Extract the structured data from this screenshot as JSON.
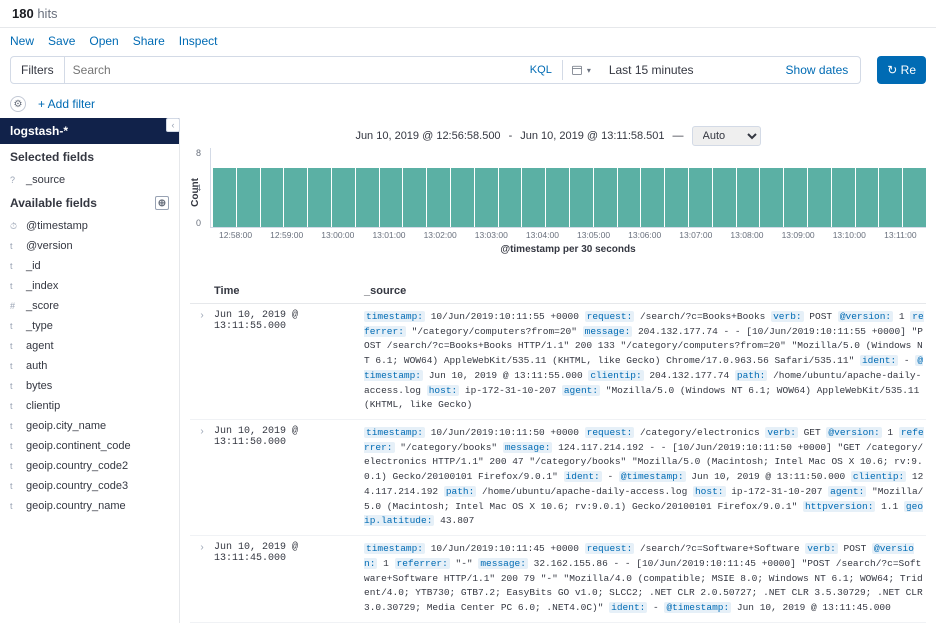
{
  "hits_count": "180",
  "hits_label": "hits",
  "menu": [
    "New",
    "Save",
    "Open",
    "Share",
    "Inspect"
  ],
  "filters_label": "Filters",
  "search_placeholder": "Search",
  "kql": "KQL",
  "time_range": "Last 15 minutes",
  "show_dates": "Show dates",
  "refresh": "Re",
  "add_filter": "+ Add filter",
  "index_pattern": "logstash-*",
  "selected_fields_label": "Selected fields",
  "selected_fields": [
    {
      "type": "?",
      "name": "_source"
    }
  ],
  "available_fields_label": "Available fields",
  "available_fields": [
    {
      "type": "⏱",
      "name": "@timestamp"
    },
    {
      "type": "t",
      "name": "@version"
    },
    {
      "type": "t",
      "name": "_id"
    },
    {
      "type": "t",
      "name": "_index"
    },
    {
      "type": "#",
      "name": "_score"
    },
    {
      "type": "t",
      "name": "_type"
    },
    {
      "type": "t",
      "name": "agent"
    },
    {
      "type": "t",
      "name": "auth"
    },
    {
      "type": "t",
      "name": "bytes"
    },
    {
      "type": "t",
      "name": "clientip"
    },
    {
      "type": "t",
      "name": "geoip.city_name"
    },
    {
      "type": "t",
      "name": "geoip.continent_code"
    },
    {
      "type": "t",
      "name": "geoip.country_code2"
    },
    {
      "type": "t",
      "name": "geoip.country_code3"
    },
    {
      "type": "t",
      "name": "geoip.country_name"
    }
  ],
  "chart_title_left": "Jun 10, 2019 @ 12:56:58.500",
  "chart_title_right": "Jun 10, 2019 @ 13:11:58.501",
  "chart_interval": "Auto",
  "xlabel": "@timestamp per 30 seconds",
  "ylabel": "Count",
  "table_headers": {
    "time": "Time",
    "source": "_source"
  },
  "chart_data": {
    "type": "bar",
    "title": "Jun 10, 2019 @ 12:56:58.500 - Jun 10, 2019 @ 13:11:58.501 — Auto",
    "xlabel": "@timestamp per 30 seconds",
    "ylabel": "Count",
    "ylim": [
      0,
      8
    ],
    "yticks": [
      8,
      4,
      0
    ],
    "categories": [
      "12:58:00",
      "12:59:00",
      "13:00:00",
      "13:01:00",
      "13:02:00",
      "13:03:00",
      "13:04:00",
      "13:05:00",
      "13:06:00",
      "13:07:00",
      "13:08:00",
      "13:09:00",
      "13:10:00",
      "13:11:00"
    ],
    "values": [
      6,
      6,
      6,
      6,
      6,
      6,
      6,
      6,
      6,
      6,
      6,
      6,
      6,
      6,
      6,
      6,
      6,
      6,
      6,
      6,
      6,
      6,
      6,
      6,
      6,
      6,
      6,
      6,
      6,
      6
    ]
  },
  "rows": [
    {
      "time": "Jun 10, 2019 @ 13:11:55.000",
      "source": "<span class='k'>timestamp:</span> 10/Jun/2019:10:11:55 +0000 <span class='k'>request:</span> /search/?c=Books+Books <span class='k'>verb:</span> POST <span class='k'>@version:</span> 1 <span class='k'>referrer:</span> \"/category/computers?from=20\" <span class='k'>message:</span> 204.132.177.74 - - [10/Jun/2019:10:11:55 +0000] \"POST /search/?c=Books+Books HTTP/1.1\" 200 133 \"/category/computers?from=20\" \"Mozilla/5.0 (Windows NT 6.1; WOW64) AppleWebKit/535.11 (KHTML, like Gecko) Chrome/17.0.963.56 Safari/535.11\" <span class='k'>ident:</span> - <span class='k'>@timestamp:</span> Jun 10, 2019 @ 13:11:55.000 <span class='k'>clientip:</span> 204.132.177.74 <span class='k'>path:</span> /home/ubuntu/apache-daily-access.log <span class='k'>host:</span> ip-172-31-10-207 <span class='k'>agent:</span> \"Mozilla/5.0 (Windows NT 6.1; WOW64) AppleWebKit/535.11 (KHTML, like Gecko)"
    },
    {
      "time": "Jun 10, 2019 @ 13:11:50.000",
      "source": "<span class='k'>timestamp:</span> 10/Jun/2019:10:11:50 +0000 <span class='k'>request:</span> /category/electronics <span class='k'>verb:</span> GET <span class='k'>@version:</span> 1 <span class='k'>referrer:</span> \"/category/books\" <span class='k'>message:</span> 124.117.214.192 - - [10/Jun/2019:10:11:50 +0000] \"GET /category/electronics HTTP/1.1\" 200 47 \"/category/books\" \"Mozilla/5.0 (Macintosh; Intel Mac OS X 10.6; rv:9.0.1) Gecko/20100101 Firefox/9.0.1\" <span class='k'>ident:</span> - <span class='k'>@timestamp:</span> Jun 10, 2019 @ 13:11:50.000 <span class='k'>clientip:</span> 124.117.214.192 <span class='k'>path:</span> /home/ubuntu/apache-daily-access.log <span class='k'>host:</span> ip-172-31-10-207 <span class='k'>agent:</span> \"Mozilla/5.0 (Macintosh; Intel Mac OS X 10.6; rv:9.0.1) Gecko/20100101 Firefox/9.0.1\" <span class='k'>httpversion:</span> 1.1 <span class='k'>geoip.latitude:</span> 43.807"
    },
    {
      "time": "Jun 10, 2019 @ 13:11:45.000",
      "source": "<span class='k'>timestamp:</span> 10/Jun/2019:10:11:45 +0000 <span class='k'>request:</span> /search/?c=Software+Software <span class='k'>verb:</span> POST <span class='k'>@version:</span> 1 <span class='k'>referrer:</span> \"-\" <span class='k'>message:</span> 32.162.155.86 - - [10/Jun/2019:10:11:45 +0000] \"POST /search/?c=Software+Software HTTP/1.1\" 200 79 \"-\" \"Mozilla/4.0 (compatible; MSIE 8.0; Windows NT 6.1; WOW64; Trident/4.0; YTB730; GTB7.2; EasyBits GO v1.0; SLCC2; .NET CLR 2.0.50727; .NET CLR 3.5.30729; .NET CLR 3.0.30729; Media Center PC 6.0; .NET4.0C)\" <span class='k'>ident:</span> - <span class='k'>@timestamp:</span> Jun 10, 2019 @ 13:11:45.000"
    }
  ]
}
